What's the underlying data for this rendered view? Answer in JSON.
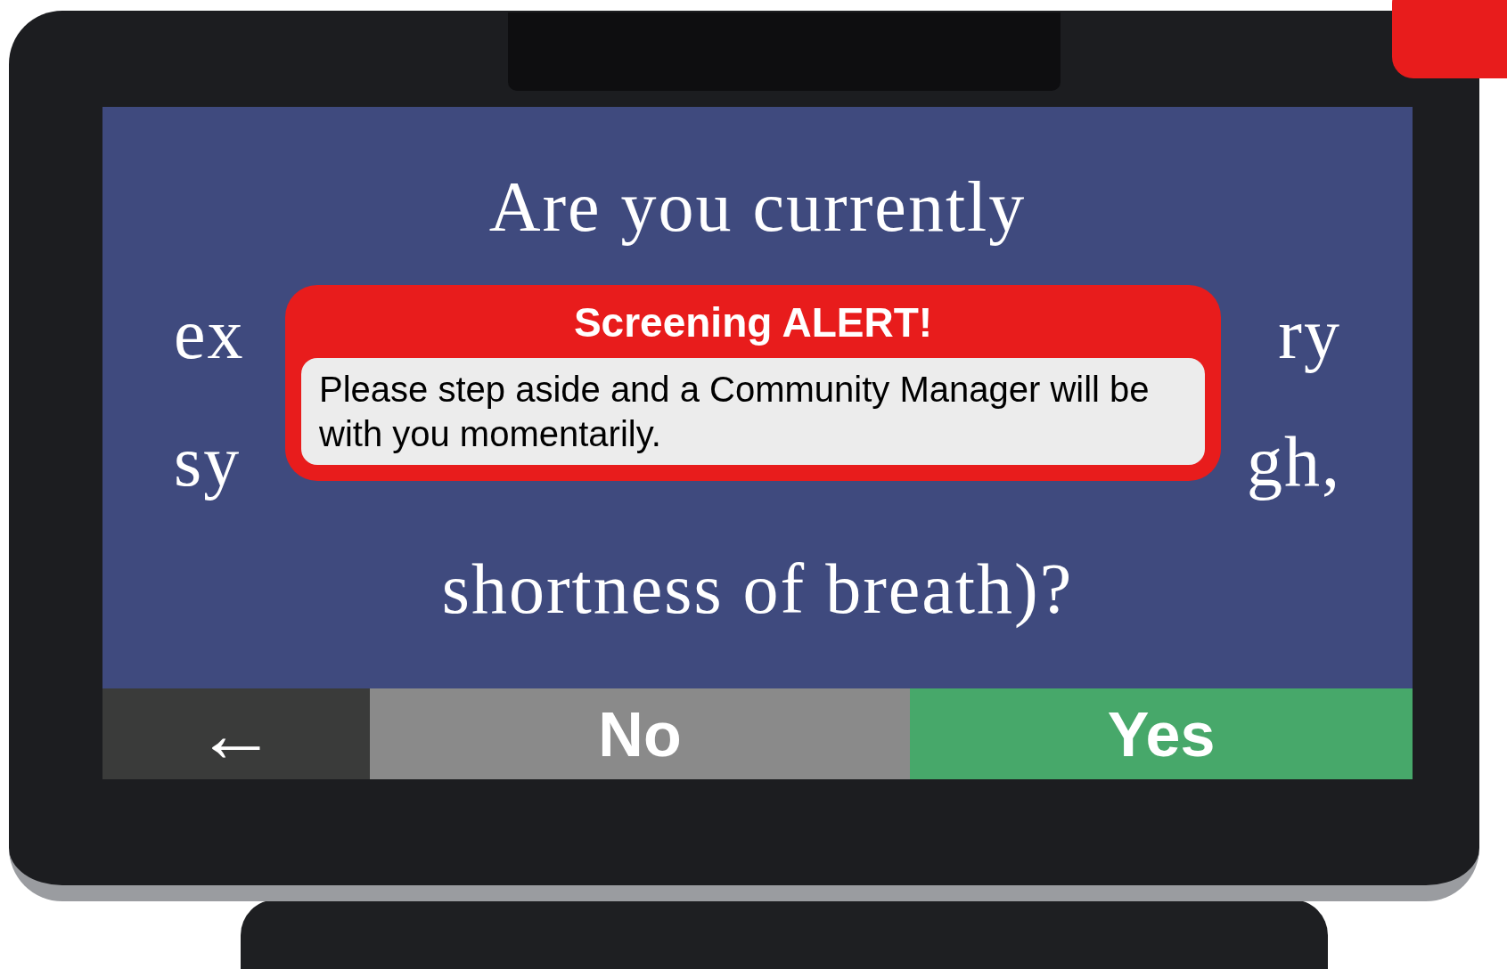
{
  "question": {
    "lines": [
      {
        "left": "Are you currently"
      },
      {
        "left": "ex",
        "right": "ry"
      },
      {
        "left": "sy",
        "right": "gh,"
      },
      {
        "left": "shortness of breath)?"
      }
    ]
  },
  "alert": {
    "title": "Screening ALERT!",
    "message": "Please step aside and a Community Manager will be with you momentarily."
  },
  "buttons": [
    {
      "kind": "back",
      "label": "←"
    },
    {
      "kind": "no",
      "label": "No"
    },
    {
      "kind": "yes",
      "label": "Yes"
    }
  ]
}
